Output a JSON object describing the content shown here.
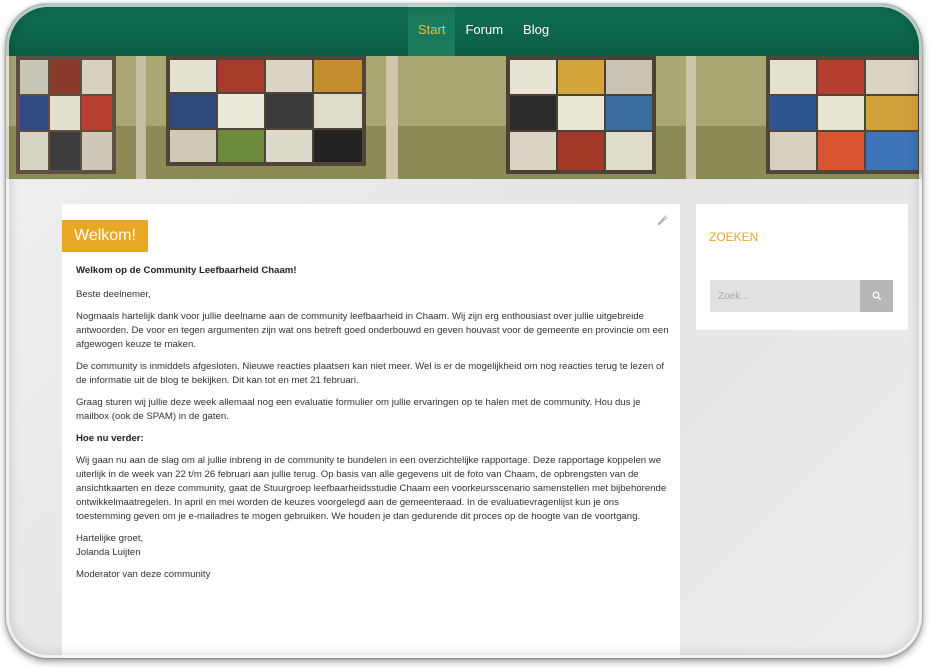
{
  "nav": {
    "items": [
      {
        "label": "Start",
        "active": true
      },
      {
        "label": "Forum",
        "active": false
      },
      {
        "label": "Blog",
        "active": false
      }
    ]
  },
  "main": {
    "tag": "Welkom!",
    "heading": "Welkom op de Community Leefbaarheid Chaam!",
    "paragraphs": [
      "Beste deelnemer,",
      "Nogmaals hartelijk dank voor jullie deelname aan de community leefbaarheid in Chaam. Wij zijn erg enthousiast over jullie uitgebreide antwoorden. De voor en tegen argumenten zijn wat ons betreft goed onderbouwd en geven houvast voor de gemeente en provincie om een afgewogen keuze te maken.",
      "De community is inmiddels afgesloten. Nieuwe reacties plaatsen kan niet meer. Wel is er de mogelijkheid om nog reacties terug te lezen of de informatie uit de blog te bekijken. Dit kan tot en met 21 februari.",
      "Graag sturen wij jullie deze week allemaal nog een evaluatie formulier om jullie ervaringen op te halen met de community. Hou dus je mailbox (ook de SPAM) in de gaten."
    ],
    "subheading": "Hoe nu verder:",
    "paragraph_next": "Wij gaan nu aan de slag om al jullie inbreng in de community te bundelen in een overzichtelijke rapportage. Deze rapportage koppelen we uiterlijk in de week van 22 t/m 26 februari aan jullie terug. Op basis van alle gegevens uit de foto van Chaam, de opbrengsten van de ansichtkaarten en deze community, gaat de Stuurgroep leefbaarheidsstudie Chaam een voorkeursscenario samenstellen met bijbehorende ontwikkelmaatregelen. In april en mei worden de keuzes voorgelegd aan de gemeenteraad. In de evaluatievragenlijst kun je ons toestemming geven om je e-mailadres te mogen gebruiken. We houden je dan gedurende dit proces op de hoogte van de voortgang.",
    "closing_1": "Hartelijke groet,",
    "closing_2": "Jolanda Luijten",
    "closing_3": "Moderator van deze community"
  },
  "sidebar": {
    "title": "ZOEKEN",
    "search_placeholder": "Zoek..."
  },
  "icons": {
    "wrench": "wrench-icon",
    "search": "search-icon"
  },
  "colors": {
    "nav_bg": "#0e6b4f",
    "nav_active": "#f5b73a",
    "accent": "#e8a823"
  }
}
